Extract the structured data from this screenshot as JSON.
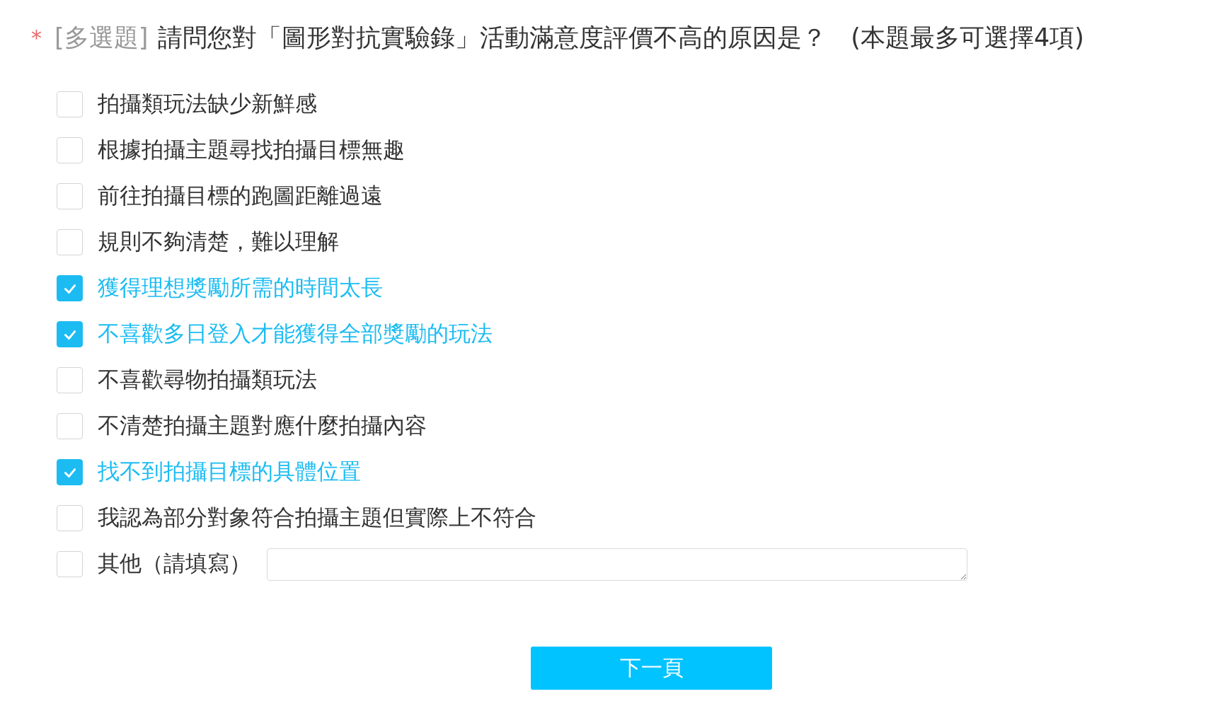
{
  "question": {
    "required_mark": "*",
    "type_tag": "[多選題]",
    "text": "請問您對「圖形對抗實驗錄」活動滿意度評價不高的原因是？",
    "hint": "(本題最多可選擇4項)"
  },
  "options": [
    {
      "kind": "checkbox",
      "label": "拍攝類玩法缺少新鮮感",
      "checked": false
    },
    {
      "kind": "checkbox",
      "label": "根據拍攝主題尋找拍攝目標無趣",
      "checked": false
    },
    {
      "kind": "checkbox",
      "label": "前往拍攝目標的跑圖距離過遠",
      "checked": false
    },
    {
      "kind": "checkbox",
      "label": "規則不夠清楚，難以理解",
      "checked": false
    },
    {
      "kind": "checkbox",
      "label": "獲得理想獎勵所需的時間太長",
      "checked": true
    },
    {
      "kind": "checkbox",
      "label": "不喜歡多日登入才能獲得全部獎勵的玩法",
      "checked": true
    },
    {
      "kind": "checkbox",
      "label": "不喜歡尋物拍攝類玩法",
      "checked": false
    },
    {
      "kind": "checkbox",
      "label": "不清楚拍攝主題對應什麼拍攝內容",
      "checked": false
    },
    {
      "kind": "checkbox",
      "label": "找不到拍攝目標的具體位置",
      "checked": true
    },
    {
      "kind": "checkbox",
      "label": "我認為部分對象符合拍攝主題但實際上不符合",
      "checked": false
    },
    {
      "kind": "other",
      "label": "其他（請填寫）",
      "checked": false
    }
  ],
  "next_button": "下一頁"
}
